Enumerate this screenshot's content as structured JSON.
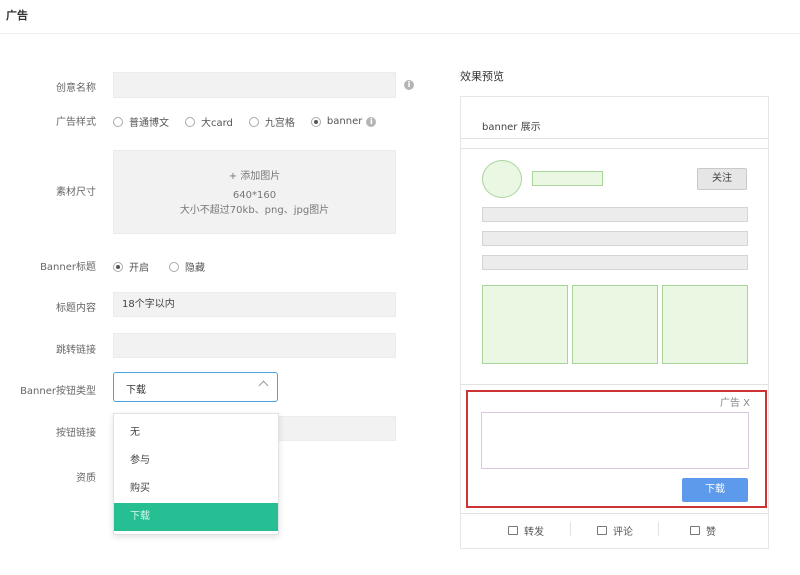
{
  "page": {
    "title": "广告"
  },
  "form": {
    "creative_name": {
      "label": "创意名称",
      "value": ""
    },
    "ad_style": {
      "label": "广告样式",
      "options": [
        "普通博文",
        "大card",
        "九宫格",
        "banner"
      ],
      "selected": "banner"
    },
    "material_size": {
      "label": "素材尺寸",
      "add_image": "+ 添加图片",
      "size": "640*160",
      "hint": "大小不超过70kb、png、jpg图片"
    },
    "banner_title": {
      "label": "Banner标题",
      "options": [
        "开启",
        "隐藏"
      ],
      "selected": "开启"
    },
    "title_content": {
      "label": "标题内容",
      "value": "18个字以内"
    },
    "jump_link": {
      "label": "跳转链接",
      "value": ""
    },
    "button_type": {
      "label": "Banner按钮类型",
      "value": "下载",
      "options": [
        "无",
        "参与",
        "购买",
        "下载"
      ],
      "highlighted": "下载"
    },
    "button_link": {
      "label": "按钮链接"
    },
    "qualification": {
      "label": "资质"
    }
  },
  "preview": {
    "title": "效果预览",
    "header": "banner 展示",
    "follow_label": "关注",
    "ad_close": "广告 X",
    "download_label": "下载",
    "actions": [
      {
        "icon": "share-icon",
        "label": "转发"
      },
      {
        "icon": "comment-icon",
        "label": "评论"
      },
      {
        "icon": "like-icon",
        "label": "赞"
      }
    ]
  },
  "colors": {
    "accent": "#4aa3df",
    "selected_option": "#26bf94",
    "ad_border": "#cc3333",
    "download_button": "#5d9aeb",
    "placeholder_green": "#e9f7e3"
  }
}
